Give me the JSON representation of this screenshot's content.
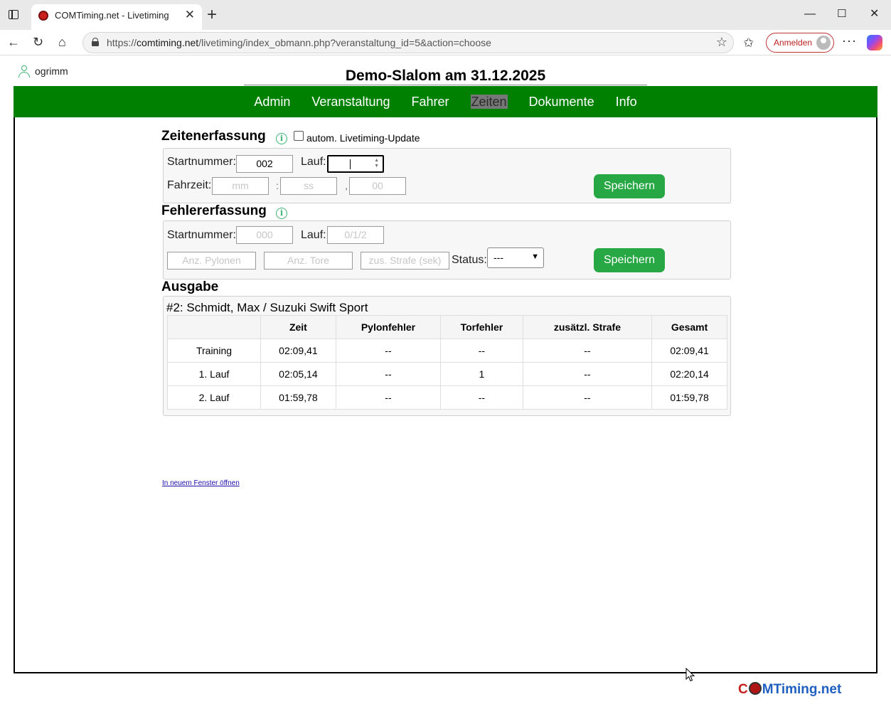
{
  "browser": {
    "tab_title": "COMTiming.net - Livetiming",
    "url_prefix": "https://",
    "url_host": "comtiming.net",
    "url_path": "/livetiming/index_obmann.php?veranstaltung_id=5&action=choose",
    "signin_label": "Anmelden",
    "icons": {
      "sidebar_toggle": "tab-actions-icon",
      "favicon": "site-favicon",
      "close": "close-icon",
      "new_tab": "plus-icon",
      "back": "back-arrow-icon",
      "reload": "reload-icon",
      "home": "home-icon",
      "lock": "lock-icon",
      "favorite": "star-icon",
      "favorites": "favorites-icon",
      "more": "more-icon",
      "copilot": "copilot-icon"
    }
  },
  "user": {
    "name": "ogrimm"
  },
  "event_title": "Demo-Slalom am 31.12.2025",
  "menu": [
    {
      "label": "Admin",
      "active": false
    },
    {
      "label": "Veranstaltung",
      "active": false
    },
    {
      "label": "Fahrer",
      "active": false
    },
    {
      "label": "Zeiten",
      "active": true
    },
    {
      "label": "Dokumente",
      "active": false
    },
    {
      "label": "Info",
      "active": false
    }
  ],
  "time_entry": {
    "heading": "Zeitenerfassung",
    "auto_update_label": "autom. Livetiming-Update",
    "auto_update_checked": false,
    "startnummer_label": "Startnummer:",
    "startnummer_value": "002",
    "lauf_label": "Lauf:",
    "lauf_value": "",
    "fahrzeit_label": "Fahrzeit:",
    "mm_placeholder": "mm",
    "ss_placeholder": "ss",
    "hundredths_placeholder": "00",
    "sep_colon": ":",
    "sep_comma": ",",
    "save_label": "Speichern"
  },
  "error_entry": {
    "heading": "Fehlererfassung",
    "startnummer_label": "Startnummer:",
    "startnummer_placeholder": "000",
    "lauf_label": "Lauf:",
    "lauf_placeholder": "0/1/2",
    "pylonen_placeholder": "Anz. Pylonen",
    "tore_placeholder": "Anz. Tore",
    "strafe_placeholder": "zus. Strafe (sek)",
    "status_label": "Status:",
    "status_value": "---",
    "save_label": "Speichern"
  },
  "output": {
    "heading": "Ausgabe",
    "driver_line": "#2: Schmidt, Max / Suzuki Swift Sport",
    "columns": [
      "",
      "Zeit",
      "Pylonfehler",
      "Torfehler",
      "zusätzl. Strafe",
      "Gesamt"
    ],
    "rows": [
      [
        "Training",
        "02:09,41",
        "--",
        "--",
        "--",
        "02:09,41"
      ],
      [
        "1. Lauf",
        "02:05,14",
        "--",
        "1",
        "--",
        "02:20,14"
      ],
      [
        "2. Lauf",
        "01:59,78",
        "--",
        "--",
        "--",
        "01:59,78"
      ]
    ],
    "new_window_link": "In neuem Fenster öffnen"
  },
  "footer": {
    "brand_part1": "C",
    "brand_part2": "MTiming.net"
  },
  "colors": {
    "menu_bg": "#008000",
    "save_button": "#28a745",
    "info_icon": "#3cb371"
  }
}
